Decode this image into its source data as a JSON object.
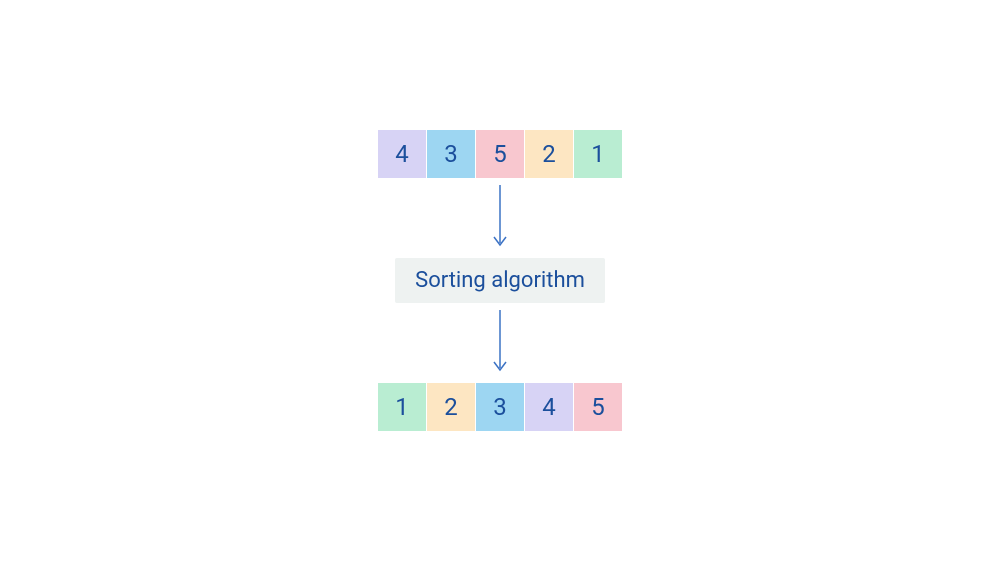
{
  "input_array": [
    {
      "value": "4",
      "color": "c-purple"
    },
    {
      "value": "3",
      "color": "c-blue"
    },
    {
      "value": "5",
      "color": "c-pink"
    },
    {
      "value": "2",
      "color": "c-peach"
    },
    {
      "value": "1",
      "color": "c-green"
    }
  ],
  "process_label": "Sorting algorithm",
  "output_array": [
    {
      "value": "1",
      "color": "c-green"
    },
    {
      "value": "2",
      "color": "c-peach"
    },
    {
      "value": "3",
      "color": "c-blue"
    },
    {
      "value": "4",
      "color": "c-purple"
    },
    {
      "value": "5",
      "color": "c-pink"
    }
  ]
}
